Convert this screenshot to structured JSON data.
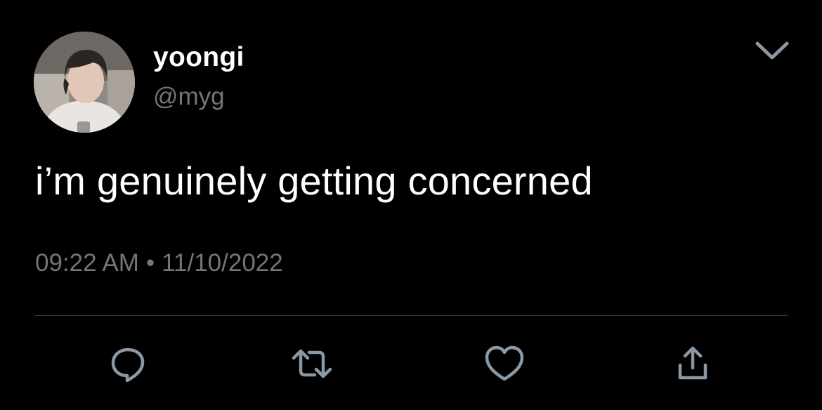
{
  "tweet": {
    "display_name": "yoongi",
    "handle": "@myg",
    "text": "i’m genuinely getting concerned",
    "time": "09:22 AM",
    "separator": "•",
    "date": "11/10/2022"
  },
  "icons": {
    "menu": "chevron-down-icon",
    "reply": "reply-bubble-icon",
    "retweet": "retweet-icon",
    "like": "heart-icon",
    "share": "share-upload-icon"
  },
  "colors": {
    "background": "#000000",
    "primary_text": "#ffffff",
    "secondary_text": "#71767b",
    "icon": "#8b98a5",
    "divider": "#3a3d40"
  }
}
